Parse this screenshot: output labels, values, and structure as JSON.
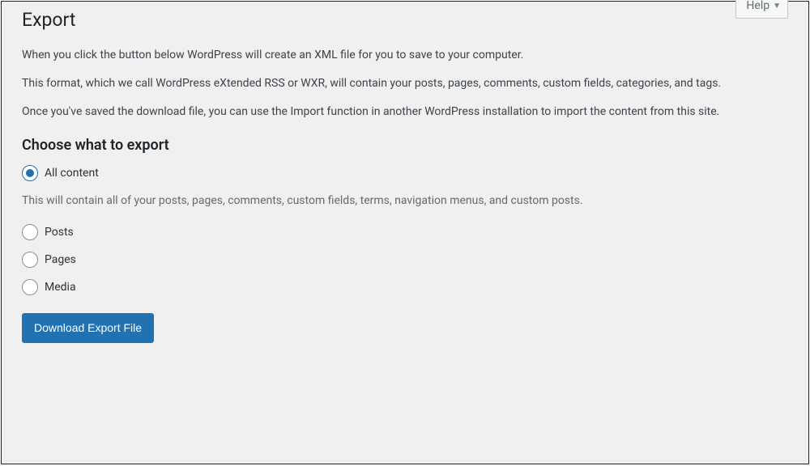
{
  "helpTab": "Help",
  "pageTitle": "Export",
  "intro1": "When you click the button below WordPress will create an XML file for you to save to your computer.",
  "intro2": "This format, which we call WordPress eXtended RSS or WXR, will contain your posts, pages, comments, custom fields, categories, and tags.",
  "intro3": "Once you've saved the download file, you can use the Import function in another WordPress installation to import the content from this site.",
  "chooseHeading": "Choose what to export",
  "options": {
    "all": {
      "label": "All content",
      "checked": true
    },
    "allDescription": "This will contain all of your posts, pages, comments, custom fields, terms, navigation menus, and custom posts.",
    "posts": {
      "label": "Posts",
      "checked": false
    },
    "pages": {
      "label": "Pages",
      "checked": false
    },
    "media": {
      "label": "Media",
      "checked": false
    }
  },
  "submitLabel": "Download Export File"
}
